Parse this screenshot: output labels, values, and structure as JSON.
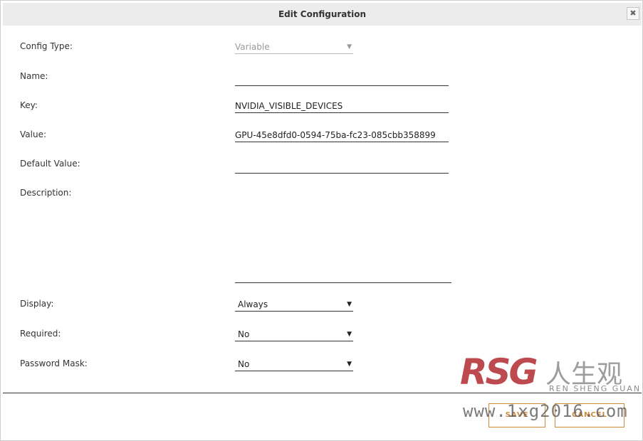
{
  "dialog": {
    "title": "Edit Configuration",
    "close_glyph": "✖"
  },
  "form": {
    "config_type": {
      "label": "Config Type:",
      "value": "Variable",
      "disabled": true
    },
    "name": {
      "label": "Name:",
      "value": ""
    },
    "key": {
      "label": "Key:",
      "value": "NVIDIA_VISIBLE_DEVICES"
    },
    "value": {
      "label": "Value:",
      "value": "GPU-45e8dfd0-0594-75ba-fc23-085cbb358899"
    },
    "default_value": {
      "label": "Default Value:",
      "value": ""
    },
    "description": {
      "label": "Description:",
      "value": ""
    },
    "display": {
      "label": "Display:",
      "value": "Always"
    },
    "required": {
      "label": "Required:",
      "value": "No"
    },
    "password_mask": {
      "label": "Password Mask:",
      "value": "No"
    },
    "dropdown_arrow": "▼"
  },
  "footer": {
    "save_label": "SAVE",
    "cancel_label": "CANCEL"
  },
  "watermark": {
    "logo": "RSG",
    "chinese": "人生观",
    "subtitle": "REN SHENG GUAN",
    "url": "www.1xg2016.com"
  },
  "colors": {
    "accent": "#d08a3c",
    "title_bar": "#ececec"
  }
}
